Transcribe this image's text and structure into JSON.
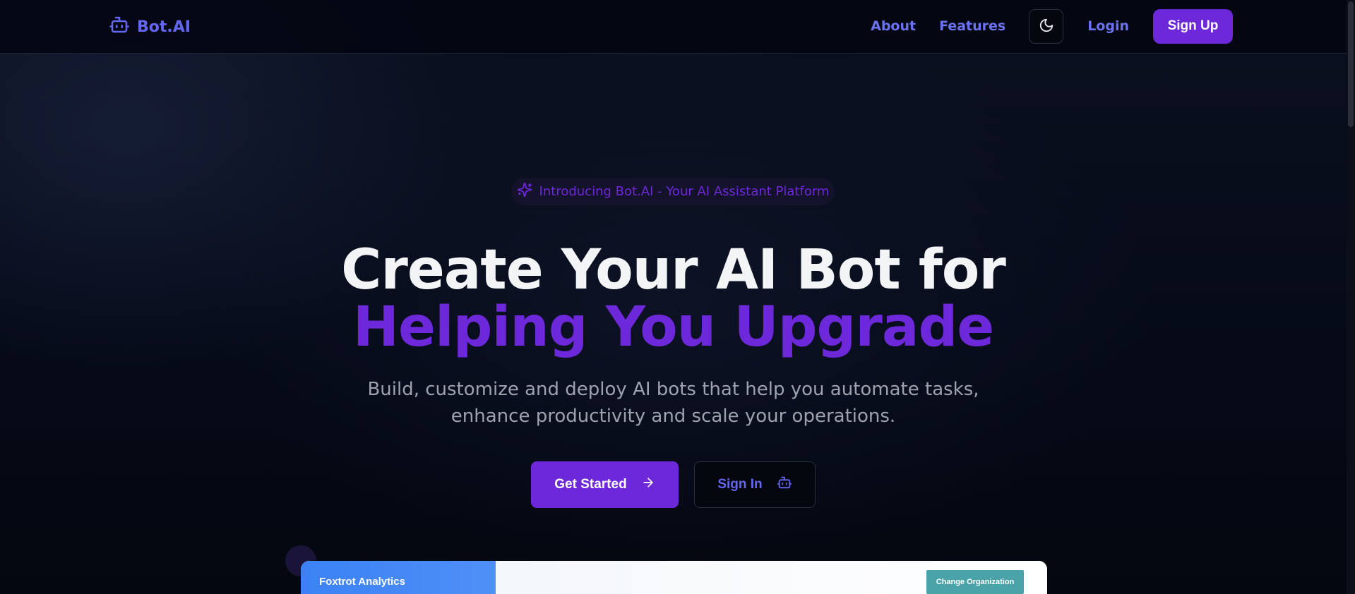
{
  "nav": {
    "brand": "Bot.AI",
    "links": [
      "About",
      "Features"
    ],
    "theme_icon": "moon-icon",
    "login": "Login",
    "signup": "Sign Up"
  },
  "hero": {
    "pill_text": "Introducing Bot.AI - Your AI Assistant Platform",
    "pill_icon": "sparkles-icon",
    "headline_line1": "Create Your AI Bot for",
    "headline_line2": "Helping You Upgrade",
    "subtitle": "Build, customize and deploy AI bots that help you automate tasks, enhance productivity and scale your operations.",
    "primary_cta": "Get Started",
    "secondary_cta": "Sign In"
  },
  "preview": {
    "sidebar_title": "Foxtrot Analytics",
    "change_org": "Change Organization"
  },
  "colors": {
    "accent": "#6d28d9",
    "brand": "#6366f1",
    "background": "#030712",
    "preview_sidebar": "#3b82f6",
    "preview_button": "#4aa3a8"
  }
}
